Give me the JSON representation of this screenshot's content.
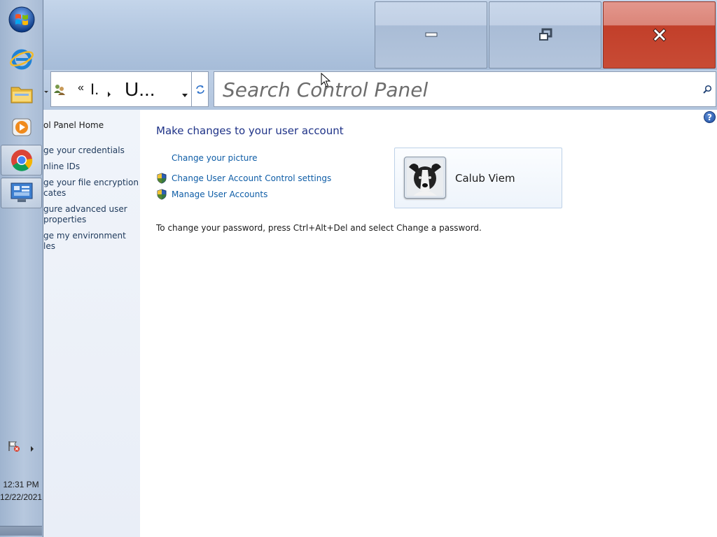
{
  "taskbar": {
    "icons": [
      "windows-start-orb-icon",
      "internet-explorer-icon",
      "file-explorer-icon",
      "media-player-icon",
      "chrome-icon",
      "control-panel-icon"
    ],
    "tray_flag_icon": "action-center-flag-icon",
    "time": "12:31 PM",
    "date": "12/22/2021"
  },
  "window": {
    "minimize_label": "Minimize",
    "maximize_label": "Restore Down",
    "close_label": "Close"
  },
  "address": {
    "overflow": "«",
    "crumb1": "I.",
    "crumb2": "U..."
  },
  "search": {
    "placeholder": "Search Control Panel"
  },
  "sidebar": {
    "items": [
      {
        "label": "ol Panel Home"
      },
      {
        "label": "ge your credentials"
      },
      {
        "label": "nline IDs"
      },
      {
        "label": "ge your file encryption",
        "label2": "cates"
      },
      {
        "label": "gure advanced user",
        "label2": "properties"
      },
      {
        "label": "ge my environment",
        "label2": "les"
      }
    ]
  },
  "main": {
    "heading": "Make changes to your user account",
    "tasks": [
      {
        "label": "Change your picture"
      },
      {
        "label": "Change User Account Control settings"
      },
      {
        "label": "Manage User Accounts"
      }
    ],
    "user_name": "Calub Viem",
    "password_note": "To change your password, press Ctrl+Alt+Del and select Change a password."
  },
  "colors": {
    "link": "#0d5ca6",
    "heading": "#1e3287",
    "close_red": "#c84b35"
  }
}
